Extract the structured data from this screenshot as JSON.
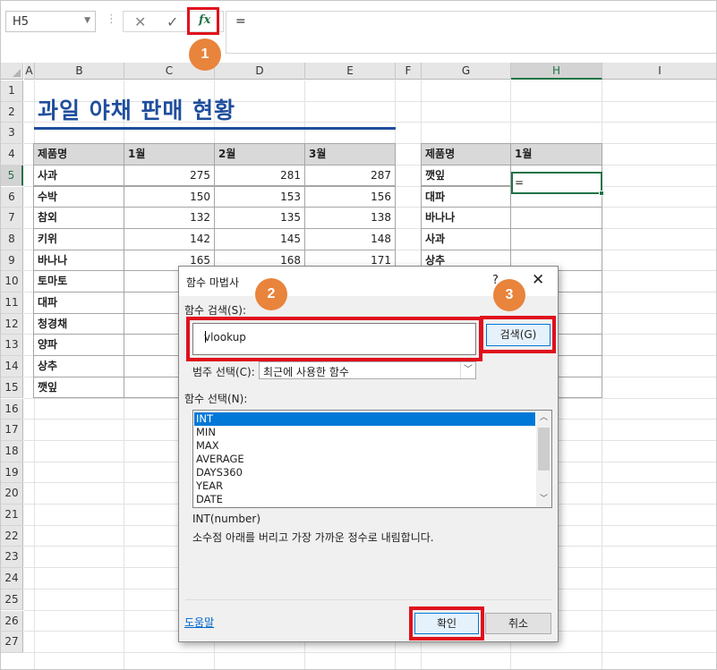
{
  "formula_bar": {
    "name_box": "H5",
    "cancel_icon": "✕",
    "enter_icon": "✓",
    "fx_icon": "fx",
    "formula": "="
  },
  "badges": [
    "1",
    "2",
    "3"
  ],
  "columns": [
    "A",
    "B",
    "C",
    "D",
    "E",
    "F",
    "G",
    "H",
    "I"
  ],
  "rows": [
    "1",
    "2",
    "3",
    "4",
    "5",
    "6",
    "7",
    "8",
    "9",
    "10",
    "11",
    "12",
    "13",
    "14",
    "15",
    "16",
    "17",
    "18",
    "19",
    "20",
    "21",
    "22",
    "23",
    "24",
    "25",
    "26",
    "27"
  ],
  "sheet": {
    "title": "과일 야채 판매 현황",
    "table1": {
      "headers": [
        "제품명",
        "1월",
        "2월",
        "3월"
      ],
      "rows": [
        {
          "name": "사과",
          "v1": "275",
          "v2": "281",
          "v3": "287"
        },
        {
          "name": "수박",
          "v1": "150",
          "v2": "153",
          "v3": "156"
        },
        {
          "name": "참외",
          "v1": "132",
          "v2": "135",
          "v3": "138"
        },
        {
          "name": "키위",
          "v1": "142",
          "v2": "145",
          "v3": "148"
        },
        {
          "name": "바나나",
          "v1": "165",
          "v2": "168",
          "v3": "171"
        },
        {
          "name": "토마토",
          "v1": "",
          "v2": "",
          "v3": ""
        },
        {
          "name": "대파",
          "v1": "",
          "v2": "",
          "v3": ""
        },
        {
          "name": "청경채",
          "v1": "",
          "v2": "",
          "v3": ""
        },
        {
          "name": "양파",
          "v1": "",
          "v2": "",
          "v3": ""
        },
        {
          "name": "상추",
          "v1": "",
          "v2": "",
          "v3": ""
        },
        {
          "name": "깻잎",
          "v1": "",
          "v2": "",
          "v3": ""
        }
      ]
    },
    "table2": {
      "headers": [
        "제품명",
        "1월"
      ],
      "rows": [
        "깻잎",
        "대파",
        "바나나",
        "사과",
        "상추"
      ]
    },
    "active_cell_value": "="
  },
  "dialog": {
    "title": "함수 마법사",
    "help": "?",
    "close": "✕",
    "search_label": "함수 검색(S):",
    "search_value": "vlookup",
    "search_button": "검색(G)",
    "category_label": "범주 선택(C):",
    "category_value": "최근에 사용한 함수",
    "function_label": "함수 선택(N):",
    "functions": [
      "INT",
      "MIN",
      "MAX",
      "AVERAGE",
      "DAYS360",
      "YEAR",
      "DATE"
    ],
    "signature": "INT(number)",
    "description": "소수점 아래를 버리고 가장 가까운 정수로 내림합니다.",
    "help_link": "도움말",
    "ok": "확인",
    "cancel": "취소"
  }
}
